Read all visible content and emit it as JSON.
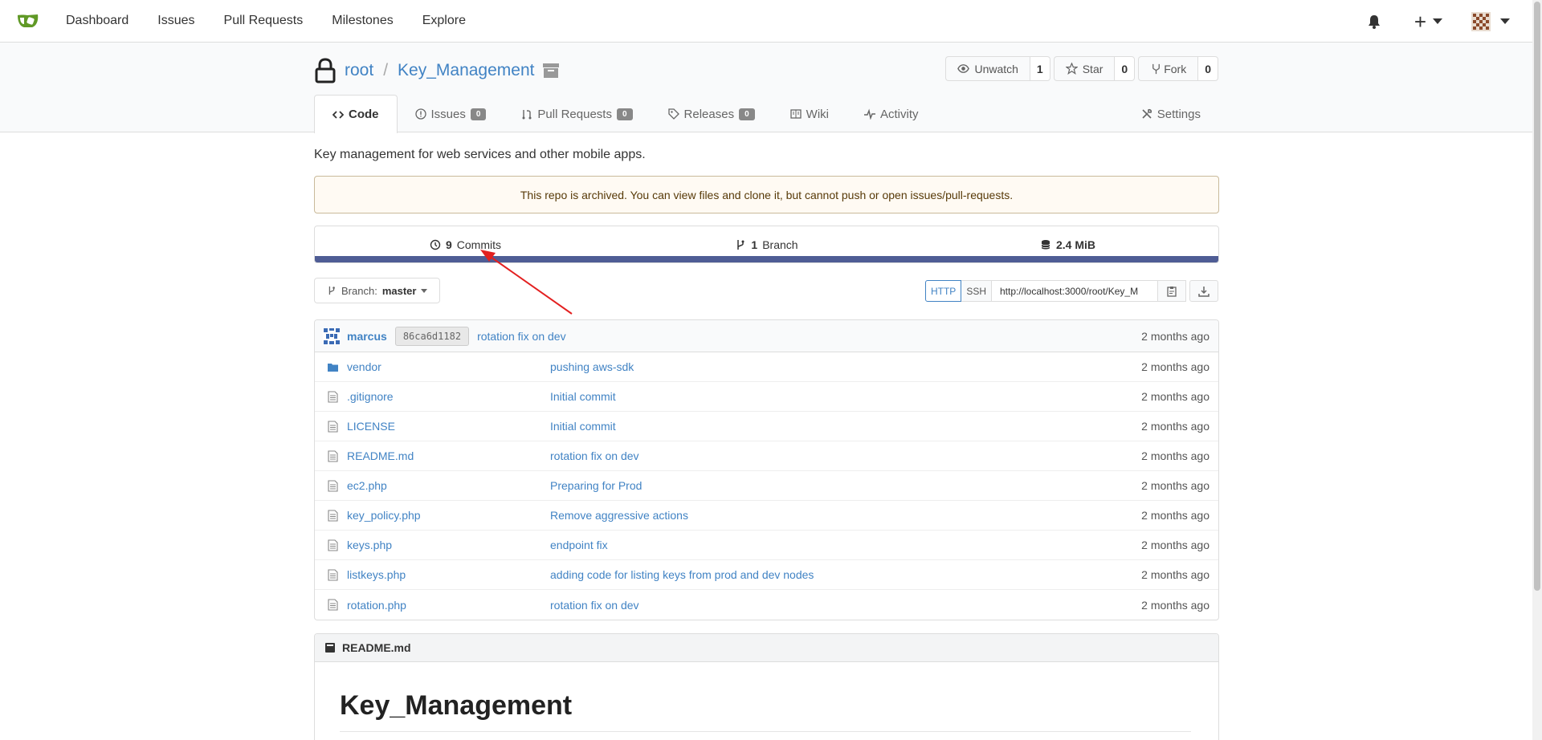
{
  "nav": {
    "items": [
      "Dashboard",
      "Issues",
      "Pull Requests",
      "Milestones",
      "Explore"
    ]
  },
  "repo": {
    "owner": "root",
    "separator": "/",
    "name": "Key_Management",
    "actions": {
      "watch_label": "Unwatch",
      "watch_count": "1",
      "star_label": "Star",
      "star_count": "0",
      "fork_label": "Fork",
      "fork_count": "0"
    },
    "tabs": {
      "code": "Code",
      "issues": "Issues",
      "issues_count": "0",
      "pulls": "Pull Requests",
      "pulls_count": "0",
      "releases": "Releases",
      "releases_count": "0",
      "wiki": "Wiki",
      "activity": "Activity",
      "settings": "Settings"
    },
    "description": "Key management for web services and other mobile apps.",
    "archived_notice": "This repo is archived. You can view files and clone it, but cannot push or open issues/pull-requests.",
    "stats": {
      "commits_count": "9",
      "commits_label": "Commits",
      "branch_count": "1",
      "branch_label": "Branch",
      "size": "2.4 MiB"
    },
    "language_color": "#4F5D95",
    "branch": {
      "prefix": "Branch:",
      "name": "master"
    },
    "clone": {
      "http_label": "HTTP",
      "ssh_label": "SSH",
      "url": "http://localhost:3000/root/Key_M"
    },
    "latest_commit": {
      "user": "marcus",
      "sha": "86ca6d1182",
      "message": "rotation fix on dev",
      "time": "2 months ago"
    },
    "files": [
      {
        "name": "vendor",
        "type": "folder",
        "message": "pushing aws-sdk",
        "time": "2 months ago"
      },
      {
        "name": ".gitignore",
        "type": "file",
        "message": "Initial commit",
        "time": "2 months ago"
      },
      {
        "name": "LICENSE",
        "type": "file",
        "message": "Initial commit",
        "time": "2 months ago"
      },
      {
        "name": "README.md",
        "type": "file",
        "message": "rotation fix on dev",
        "time": "2 months ago"
      },
      {
        "name": "ec2.php",
        "type": "file",
        "message": "Preparing for Prod",
        "time": "2 months ago"
      },
      {
        "name": "key_policy.php",
        "type": "file",
        "message": "Remove aggressive actions",
        "time": "2 months ago"
      },
      {
        "name": "keys.php",
        "type": "file",
        "message": "endpoint fix",
        "time": "2 months ago"
      },
      {
        "name": "listkeys.php",
        "type": "file",
        "message": "adding code for listing keys from prod and dev nodes",
        "time": "2 months ago"
      },
      {
        "name": "rotation.php",
        "type": "file",
        "message": "rotation fix on dev",
        "time": "2 months ago"
      }
    ],
    "readme": {
      "filename": "README.md",
      "heading": "Key_Management"
    }
  },
  "colors": {
    "link": "#4183c4",
    "annotation_arrow": "#e32020",
    "logo_green": "#609926"
  }
}
